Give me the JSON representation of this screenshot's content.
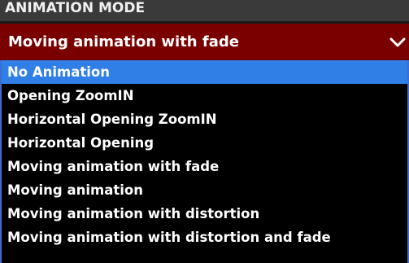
{
  "header": {
    "title": "ANIMATION MODE"
  },
  "select": {
    "value": "Moving animation with fade",
    "icon": "chevron-down-icon"
  },
  "options": [
    {
      "label": "No Animation",
      "highlighted": true
    },
    {
      "label": "Opening ZoomIN",
      "highlighted": false
    },
    {
      "label": "Horizontal Opening ZoomIN",
      "highlighted": false
    },
    {
      "label": "Horizontal Opening",
      "highlighted": false
    },
    {
      "label": "Moving animation with fade",
      "highlighted": false
    },
    {
      "label": "Moving animation",
      "highlighted": false
    },
    {
      "label": "Moving animation with distortion",
      "highlighted": false
    },
    {
      "label": "Moving animation with distortion and fade",
      "highlighted": false
    }
  ],
  "colors": {
    "header_bg": "#3a3a3a",
    "select_bg": "#7a0000",
    "list_bg": "#000000",
    "highlight_bg": "#2f7fe6",
    "list_border": "#3b6dd3"
  }
}
